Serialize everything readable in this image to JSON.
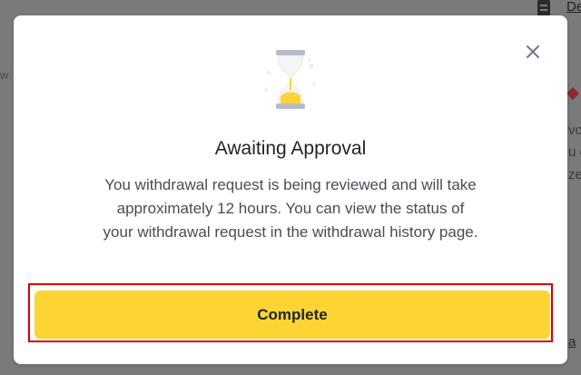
{
  "background": {
    "link_label": "De",
    "left_fragment": "w",
    "right_fragments": [
      "vo",
      "u o",
      "ze",
      "a"
    ]
  },
  "modal": {
    "title": "Awaiting Approval",
    "message": "You withdrawal request is being reviewed and will take approximately 12 hours. You can view the status of your withdrawal request in the withdrawal history page.",
    "button_label": "Complete",
    "close_icon": "close-icon",
    "hourglass_icon": "hourglass-icon"
  },
  "colors": {
    "accent": "#fcd535",
    "focus_ring": "#d70000",
    "title": "#1f2329",
    "body_text": "#474d57",
    "overlay": "#7a7a7a"
  }
}
